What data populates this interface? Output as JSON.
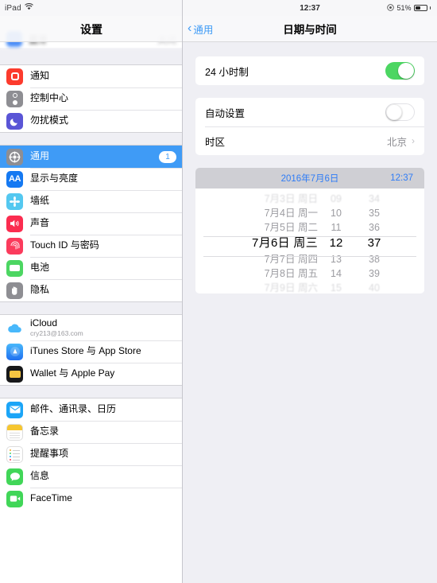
{
  "left": {
    "status": {
      "device": "iPad",
      "wifi_icon": "wifi-icon"
    },
    "navbar": {
      "title": "设置"
    },
    "scrolled_row": {
      "label": "蓝牙",
      "value": "关闭",
      "icon": "bluetooth-icon"
    },
    "groups": [
      {
        "items": [
          {
            "label": "通知",
            "icon": "notifications-icon"
          },
          {
            "label": "控制中心",
            "icon": "control-center-icon"
          },
          {
            "label": "勿扰模式",
            "icon": "do-not-disturb-icon"
          }
        ]
      },
      {
        "items": [
          {
            "label": "通用",
            "icon": "general-gear-icon",
            "badge": "1",
            "selected": true
          },
          {
            "label": "显示与亮度",
            "icon": "display-brightness-icon"
          },
          {
            "label": "墙纸",
            "icon": "wallpaper-icon"
          },
          {
            "label": "声音",
            "icon": "sound-icon"
          },
          {
            "label": "Touch ID 与密码",
            "icon": "touch-id-icon"
          },
          {
            "label": "电池",
            "icon": "battery-icon"
          },
          {
            "label": "隐私",
            "icon": "privacy-hand-icon"
          }
        ]
      },
      {
        "items": [
          {
            "label": "iCloud",
            "sublabel": "cry213@163.com",
            "icon": "icloud-icon"
          },
          {
            "label": "iTunes Store 与 App Store",
            "icon": "itunes-app-store-icon"
          },
          {
            "label": "Wallet 与 Apple Pay",
            "icon": "wallet-icon"
          }
        ]
      },
      {
        "items": [
          {
            "label": "邮件、通讯录、日历",
            "icon": "mail-icon"
          },
          {
            "label": "备忘录",
            "icon": "notes-icon"
          },
          {
            "label": "提醒事项",
            "icon": "reminders-icon"
          },
          {
            "label": "信息",
            "icon": "messages-icon"
          },
          {
            "label": "FaceTime",
            "icon": "facetime-icon"
          }
        ]
      }
    ]
  },
  "right": {
    "status": {
      "time": "12:37",
      "battery_percent": "51%",
      "rotation_lock_icon": "rotation-lock-icon"
    },
    "navbar": {
      "back_label": "通用",
      "title": "日期与时间"
    },
    "rows": {
      "hour24_label": "24 小时制",
      "hour24_state": "on",
      "auto_label": "自动设置",
      "auto_state": "off",
      "timezone_label": "时区",
      "timezone_value": "北京"
    },
    "picker": {
      "header_date": "2016年7月6日",
      "header_time": "12:37",
      "dates": [
        "7月3日 周日",
        "7月4日 周一",
        "7月5日 周二",
        "7月6日 周三",
        "7月7日 周四",
        "7月8日 周五",
        "7月9日 周六"
      ],
      "hours": [
        "09",
        "10",
        "11",
        "12",
        "13",
        "14",
        "15"
      ],
      "minutes": [
        "34",
        "35",
        "36",
        "37",
        "38",
        "39",
        "40"
      ],
      "selected_index": 3
    }
  },
  "colors": {
    "accent_blue": "#3f9bf6",
    "toggle_green": "#4cd662",
    "group_bg": "#efeff4"
  }
}
